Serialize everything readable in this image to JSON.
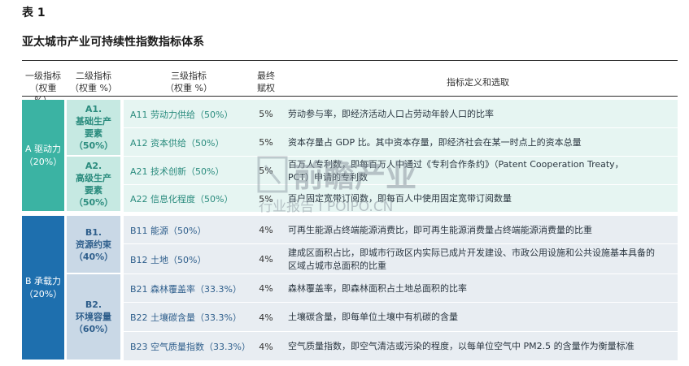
{
  "header": {
    "table_label": "表 1",
    "table_title": "亚太城市产业可持续性指数指标体系",
    "col1": "一级指标\n（权重 %）",
    "col2": "二级指标\n（权重 %）",
    "col3": "三级指标\n（权重 %）",
    "col4": "最终\n赋权",
    "col5": "指标定义和选取"
  },
  "colors": {
    "level1_a": "#3bb3a3",
    "level1_b": "#1e6fae",
    "level2_a": "#c6e9e2",
    "level2_b": "#c9d8e6",
    "row_a": "#e6f5f2",
    "row_b": "#e8edf2",
    "text_a": "#2b8c7e",
    "text_b": "#2f5f8c"
  },
  "groups": [
    {
      "label": "A 驱动力\n（20%）",
      "subgroups": [
        {
          "label": "A1.\n基础生产\n要素\n（50%）",
          "rows": [
            {
              "indicator": "A11 劳动力供给（50%）",
              "weight": "5%",
              "definition": "劳动参与率，即经济活动人口占劳动年龄人口的比率"
            },
            {
              "indicator": "A12 资本供给（50%）",
              "weight": "5%",
              "definition": "资本存量占 GDP 比。其中资本存量，即经济社会在某一时点上的资本总量"
            }
          ]
        },
        {
          "label": "A2.\n高级生产\n要素\n（50%）",
          "rows": [
            {
              "indicator": "A21 技术创新（50%）",
              "weight": "5%",
              "definition": "百万人专利数，即每百万人中通过《专利合作条约》（Patent Cooperation Treaty，\nPCT）申请的专利数"
            },
            {
              "indicator": "A22 信息化程度（50%）",
              "weight": "5%",
              "definition": "百户固定宽带订阅数，即每百人中使用固定宽带订阅数量"
            }
          ]
        }
      ]
    },
    {
      "label": "B 承载力\n（20%）",
      "subgroups": [
        {
          "label": "B1.\n资源约束\n（40%）",
          "rows": [
            {
              "indicator": "B11 能源（50%）",
              "weight": "4%",
              "definition": "可再生能源占终端能源消费比，即可再生能源消费量占终端能源消费量的比重"
            },
            {
              "indicator": "B12 土地（50%）",
              "weight": "4%",
              "definition": "建成区面积占比，即城市行政区内实际已成片开发建设、市政公用设施和公共设施基本具备的\n区域占城市总面积的比重"
            }
          ]
        },
        {
          "label": "B2.\n环境容量\n（60%）",
          "rows": [
            {
              "indicator": "B21 森林覆盖率（33.3%）",
              "weight": "4%",
              "definition": "森林覆盖率，即森林面积占土地总面积的比率"
            },
            {
              "indicator": "B22 土壤碳含量（33.3%）",
              "weight": "4%",
              "definition": "土壤碳含量，即每单位土壤中有机碳的含量"
            },
            {
              "indicator": "B23 空气质量指数（33.3%）",
              "weight": "4%",
              "definition": "空气质量指数，即空气清洁或污染的程度，以每单位空气中 PM2.5 的含量作为衡量标准"
            }
          ]
        }
      ]
    }
  ],
  "watermark": {
    "main": "前瞻产业",
    "sub": "行业报告 I POIPO.CN"
  }
}
